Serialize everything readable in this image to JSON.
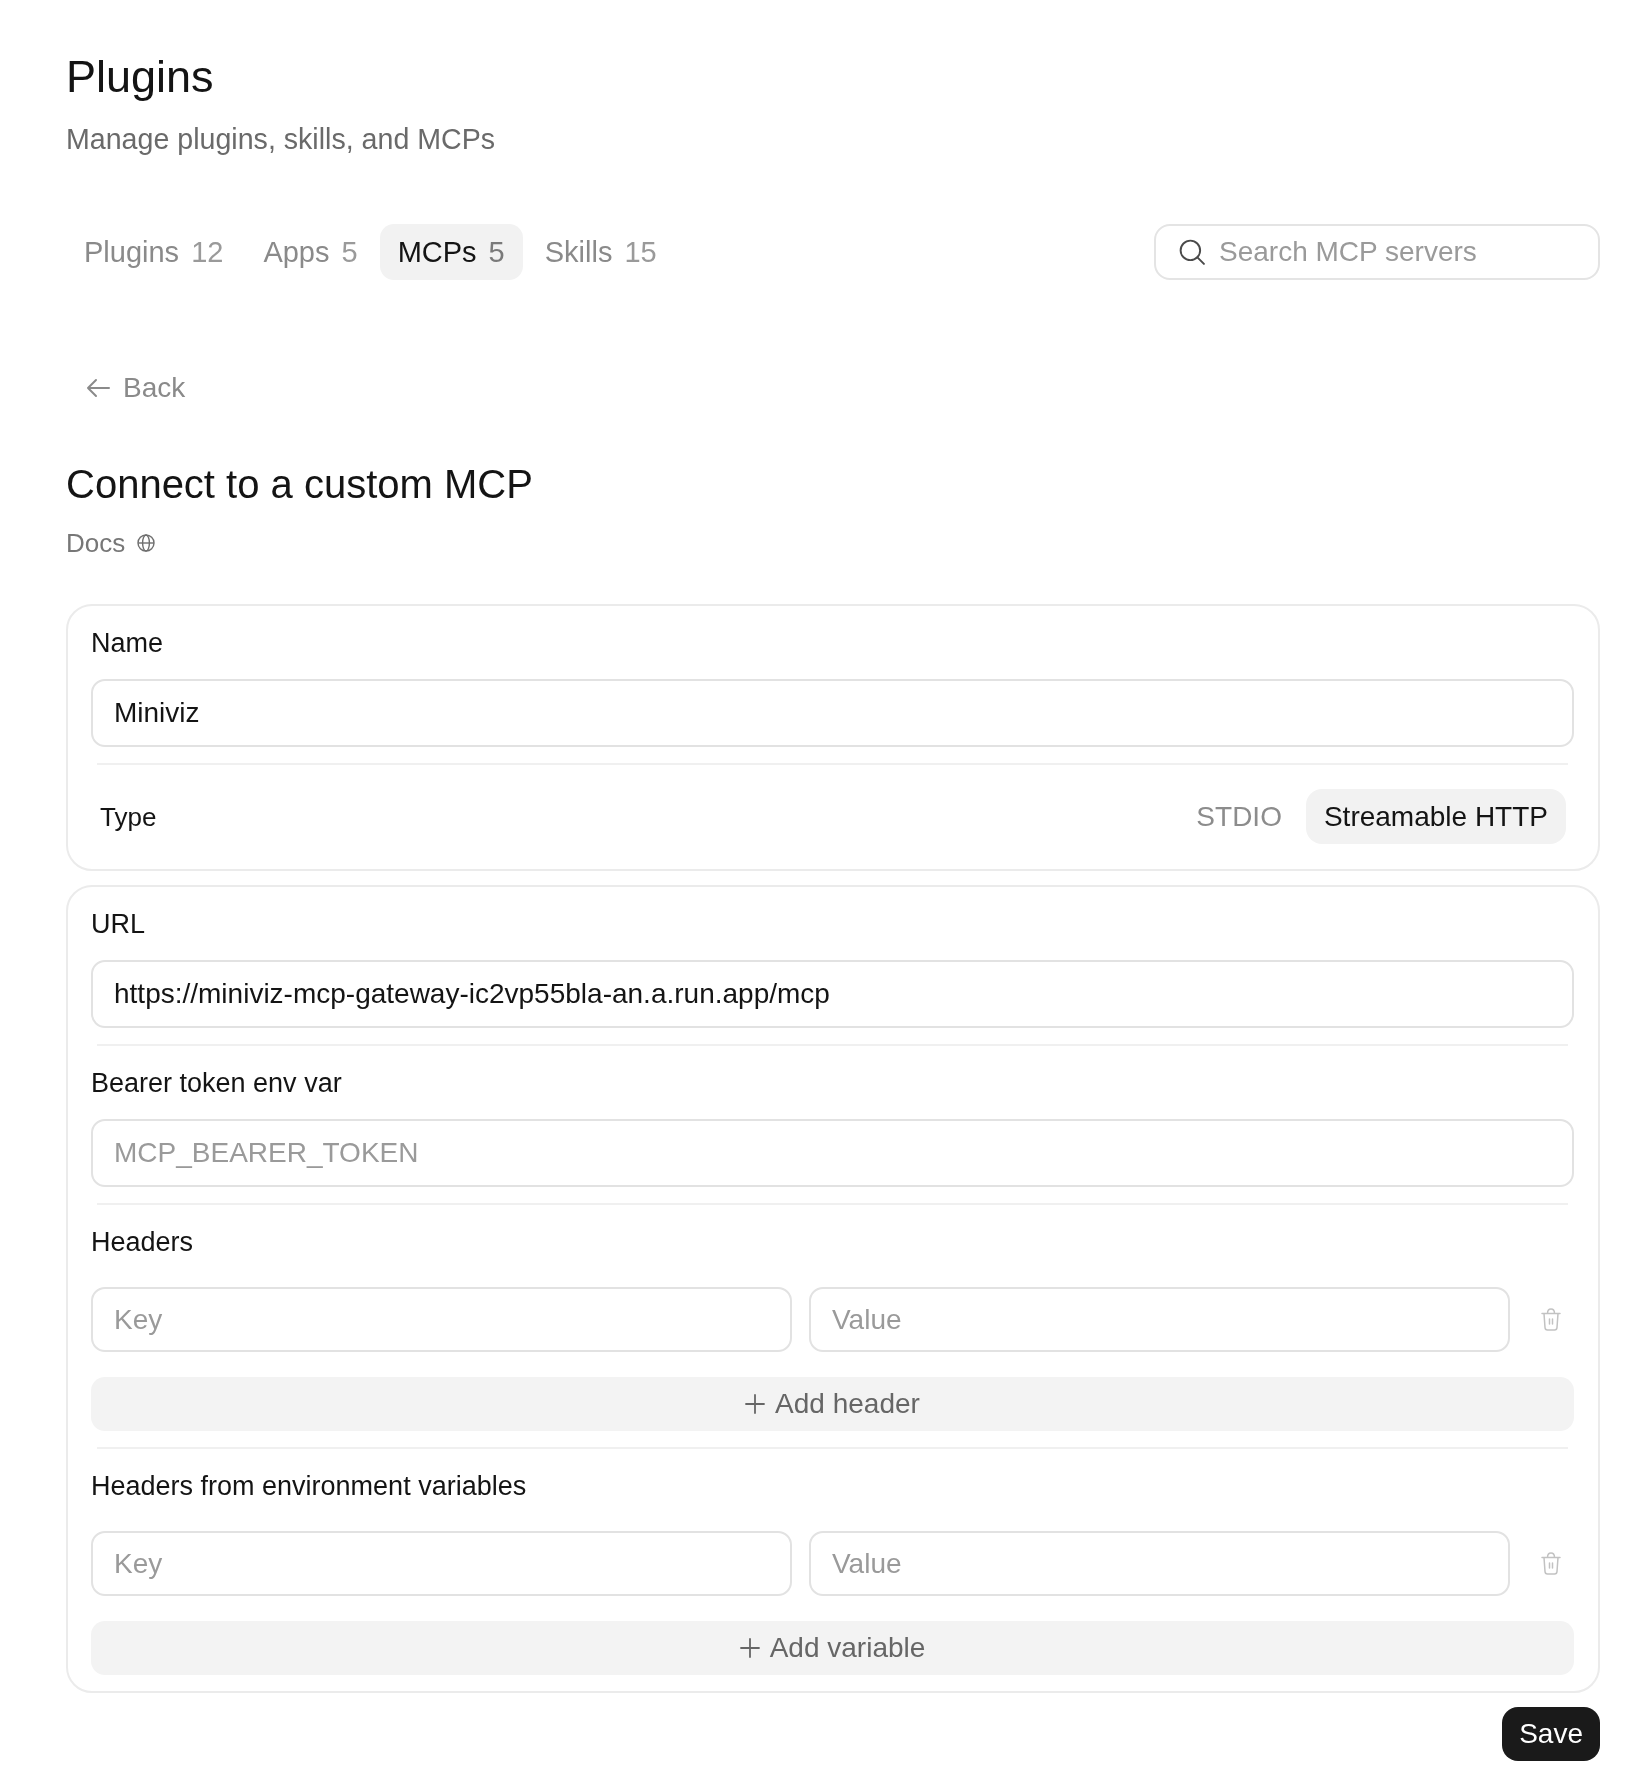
{
  "header": {
    "title": "Plugins",
    "subtitle": "Manage plugins, skills, and MCPs"
  },
  "tabs": [
    {
      "label": "Plugins",
      "count": "12",
      "selected": false
    },
    {
      "label": "Apps",
      "count": "5",
      "selected": false
    },
    {
      "label": "MCPs",
      "count": "5",
      "selected": true
    },
    {
      "label": "Skills",
      "count": "15",
      "selected": false
    }
  ],
  "search": {
    "placeholder": "Search MCP servers"
  },
  "back_button": {
    "label": "Back"
  },
  "form": {
    "title": "Connect to a custom MCP",
    "docs_link": "Docs",
    "cards": [
      {
        "fields": [
          {
            "kind": "text_input",
            "label": "Name",
            "value": "Miniviz"
          },
          {
            "kind": "segmented",
            "label": "Type",
            "options": [
              {
                "label": "STDIO",
                "selected": false
              },
              {
                "label": "Streamable HTTP",
                "selected": true
              }
            ]
          }
        ]
      },
      {
        "fields": [
          {
            "kind": "text_input",
            "label": "URL",
            "value": "https://miniviz-mcp-gateway-ic2vp55bla-an.a.run.app/mcp"
          },
          {
            "kind": "text_input",
            "label": "Bearer token env var",
            "placeholder": "MCP_BEARER_TOKEN"
          },
          {
            "kind": "key_value",
            "label": "Headers",
            "rows": [
              {
                "key_placeholder": "Key",
                "value_placeholder": "Value"
              }
            ],
            "add_label": "Add header"
          },
          {
            "kind": "key_value",
            "label": "Headers from environment variables",
            "rows": [
              {
                "key_placeholder": "Key",
                "value_placeholder": "Value"
              }
            ],
            "add_label": "Add variable"
          }
        ]
      }
    ],
    "save_button": "Save"
  }
}
